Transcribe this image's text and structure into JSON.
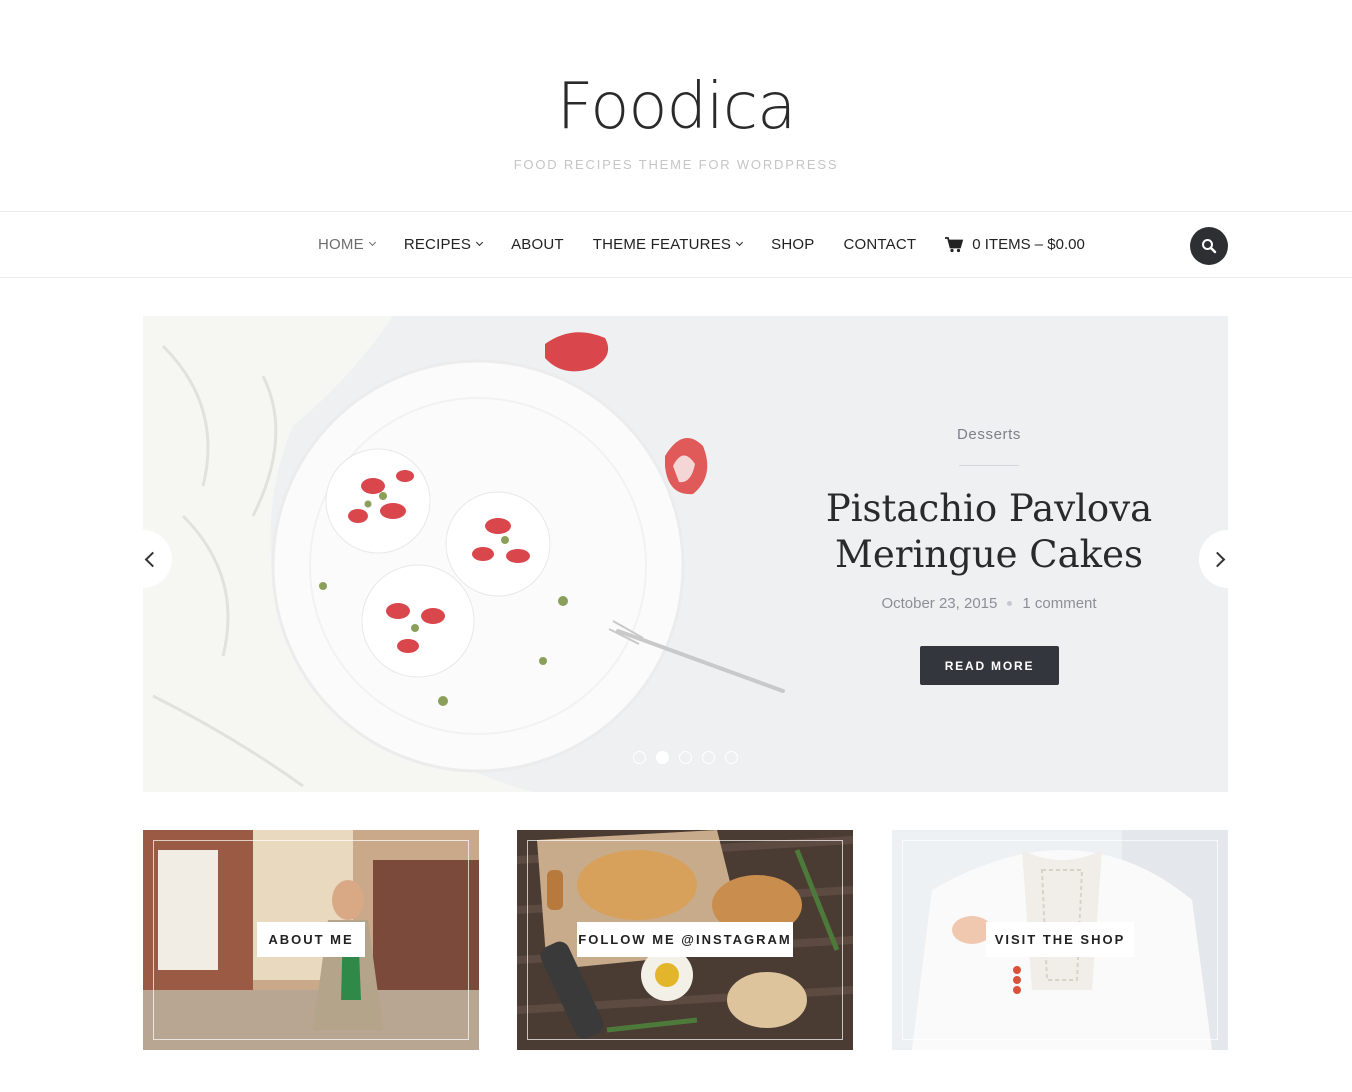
{
  "site": {
    "title": "Foodica",
    "tagline": "FOOD RECIPES THEME FOR WORDPRESS"
  },
  "nav": {
    "items": [
      {
        "label": "HOME",
        "has_dropdown": true,
        "active": true
      },
      {
        "label": "RECIPES",
        "has_dropdown": true
      },
      {
        "label": "ABOUT",
        "has_dropdown": false
      },
      {
        "label": "THEME FEATURES",
        "has_dropdown": true
      },
      {
        "label": "SHOP",
        "has_dropdown": false
      },
      {
        "label": "CONTACT",
        "has_dropdown": false
      }
    ],
    "cart_label": "0 ITEMS – $0.00",
    "cart_icon": "cart-icon",
    "search_icon": "search-icon"
  },
  "slider": {
    "category": "Desserts",
    "title_line1": "Pistachio Pavlova",
    "title_line2": "Meringue Cakes",
    "date": "October 23, 2015",
    "comments": "1 comment",
    "button_label": "READ MORE",
    "slide_count": 5,
    "active_slide": 2
  },
  "promos": [
    {
      "label": "ABOUT ME"
    },
    {
      "label": "FOLLOW ME @INSTAGRAM"
    },
    {
      "label": "VISIT THE SHOP"
    }
  ],
  "colors": {
    "accent_dark": "#33363c",
    "slider_bg": "#eef0f2",
    "tagline": "#c5c5c5"
  }
}
